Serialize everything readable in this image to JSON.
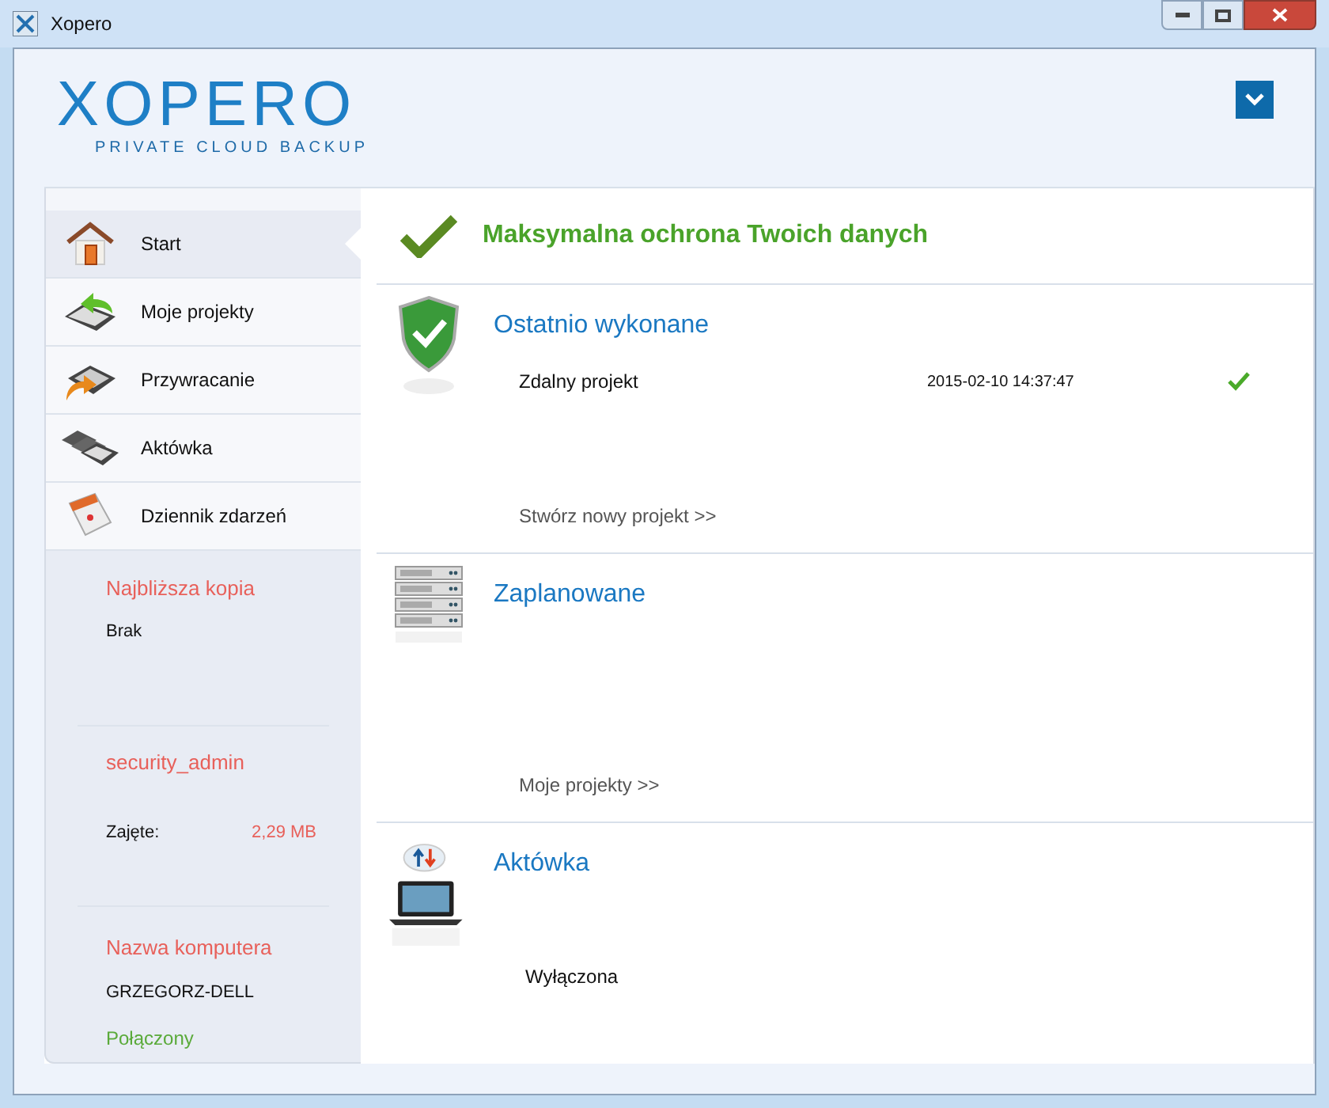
{
  "window": {
    "title": "Xopero"
  },
  "logo": {
    "name": "XOPERO",
    "tagline": "PRIVATE CLOUD BACKUP"
  },
  "sidebar": {
    "items": [
      {
        "label": "Start",
        "kind": "home",
        "selected": true
      },
      {
        "label": "Moje projekty",
        "kind": "backup",
        "selected": false
      },
      {
        "label": "Przywracanie",
        "kind": "restore",
        "selected": false
      },
      {
        "label": "Aktówka",
        "kind": "briefcase",
        "selected": false
      },
      {
        "label": "Dziennik zdarzeń",
        "kind": "log",
        "selected": false
      }
    ],
    "next_copy": {
      "title": "Najbliższa kopia",
      "value": "Brak"
    },
    "account": {
      "user": "security_admin",
      "usage_label": "Zajęte:",
      "usage_value": "2,29 MB"
    },
    "computer": {
      "title": "Nazwa komputera",
      "name": "GRZEGORZ-DELL",
      "status": "Połączony"
    }
  },
  "status": {
    "message": "Maksymalna ochrona Twoich danych"
  },
  "sections": [
    {
      "kind": "recent",
      "title": "Ostatnio wykonane",
      "rows": [
        {
          "name": "Zdalny projekt",
          "time": "2015-02-10 14:37:47",
          "success": true
        }
      ],
      "link": "Stwórz nowy projekt >>"
    },
    {
      "kind": "scheduled",
      "title": "Zaplanowane",
      "link": "Moje projekty >>"
    },
    {
      "kind": "briefcase",
      "title": "Aktówka",
      "value": "Wyłączona"
    }
  ]
}
